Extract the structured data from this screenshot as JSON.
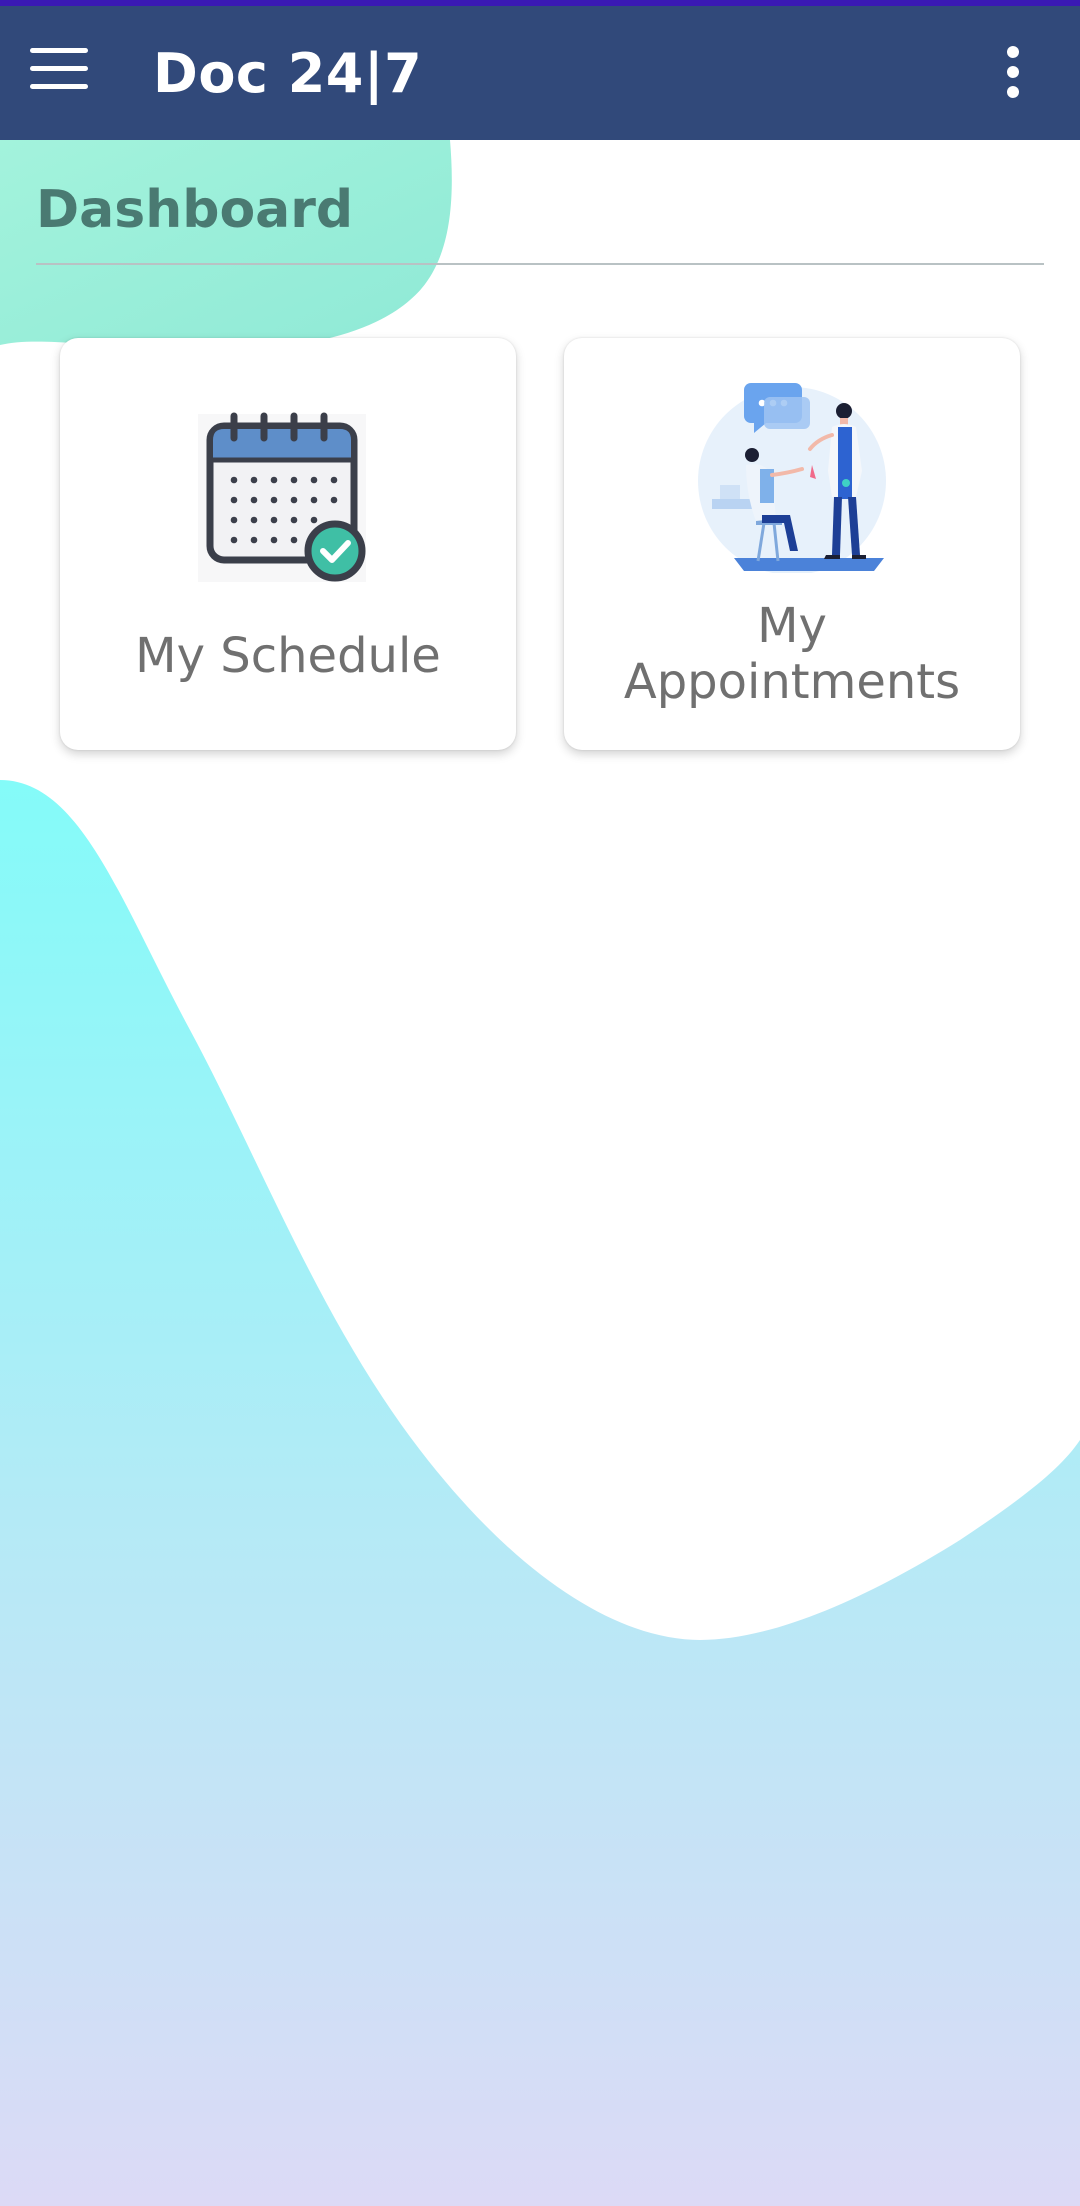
{
  "appbar": {
    "title": "Doc 24|7",
    "menu_icon": "hamburger-menu-icon",
    "overflow_icon": "more-vert-icon"
  },
  "dashboard": {
    "title": "Dashboard",
    "cards": [
      {
        "label": "My Schedule",
        "icon": "calendar-check-icon"
      },
      {
        "label": "My\nAppointments",
        "icon": "doctor-patient-icon"
      }
    ]
  },
  "colors": {
    "appbar": "#31497a",
    "statusbar": "#3a19b3",
    "heading": "#4a7a72",
    "label": "#707070",
    "blob_top": "#8cf0e0",
    "gradient_top": "#84fbf9",
    "gradient_bottom": "#dcdaf6"
  }
}
